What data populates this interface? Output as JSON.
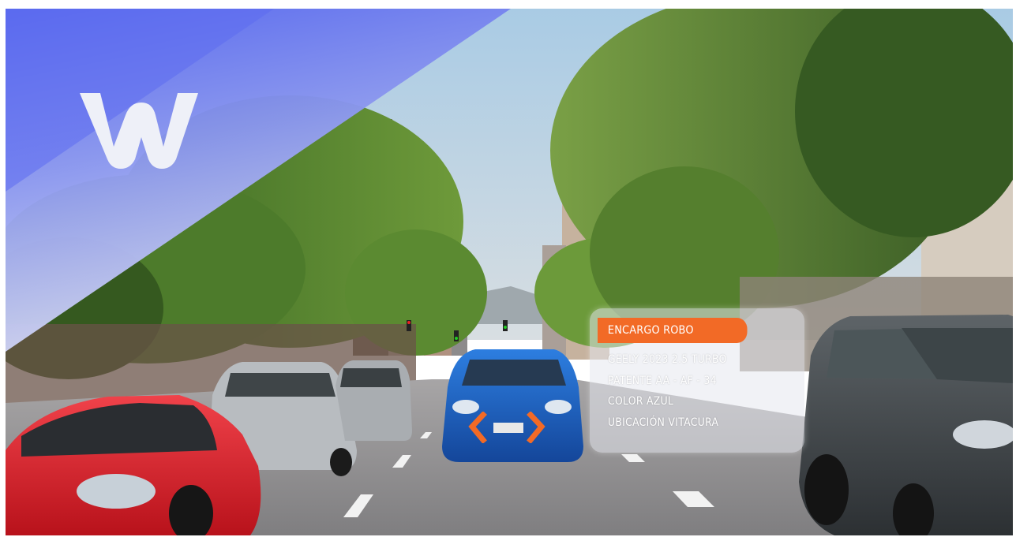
{
  "image": {
    "subject": "street scene with cars driving on a tree-lined avenue",
    "colors": {
      "banner_blue": "#5566ee",
      "banner_light": "#c9cdf5",
      "sky": "#b8d3e6",
      "road": "#8f8d8f",
      "red_car": "#e0232c",
      "blue_car": "#1e63c8",
      "accent_orange": "#f26a26"
    }
  },
  "logo": {
    "icon": "w-brand-logo"
  },
  "info_card": {
    "tag": "ENCARGO ROBO",
    "lines": [
      "GEELY  2023 2.5  TURBO",
      "PATENTE  AA - AF - 34",
      "COLOR  AZUL",
      "UBICACIÓN VITACURA"
    ]
  },
  "highlight": {
    "icon": "target-bracket-icons"
  }
}
